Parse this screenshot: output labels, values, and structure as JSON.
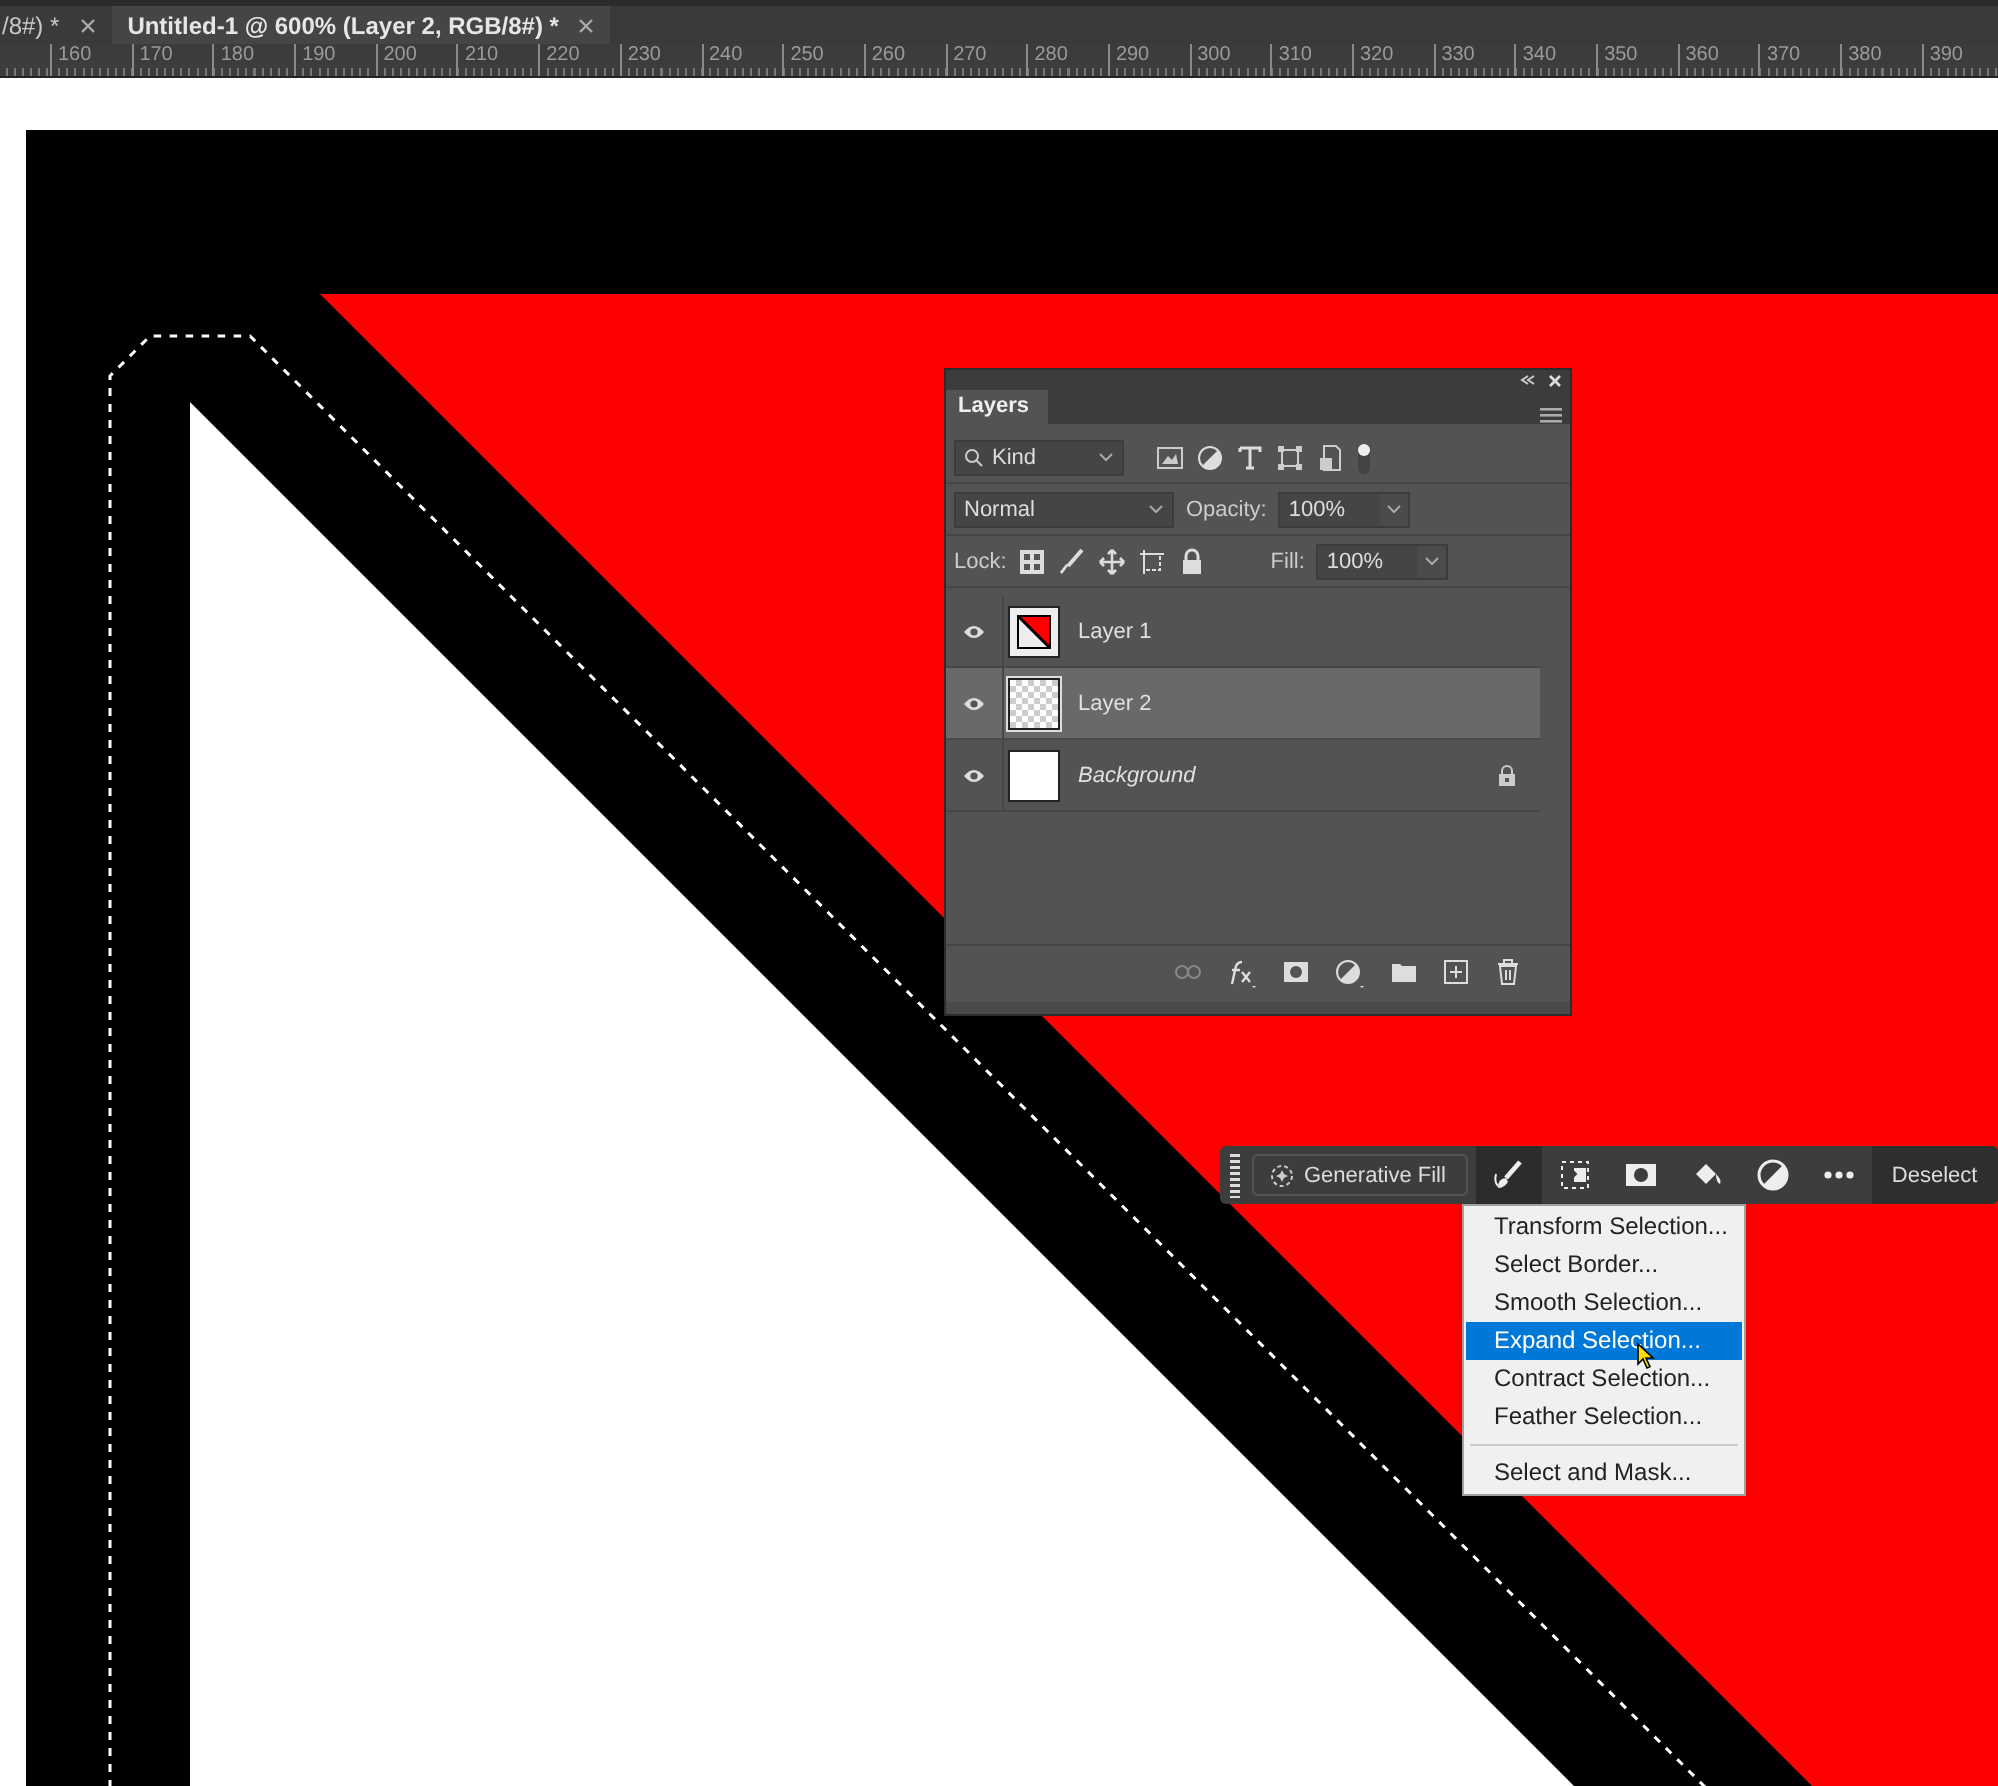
{
  "tabs": [
    {
      "label": "/8#) *",
      "selected": false
    },
    {
      "label": "Untitled-1 @ 600% (Layer 2, RGB/8#) *",
      "selected": true
    }
  ],
  "ruler": {
    "labels": [
      "160",
      "170",
      "180",
      "190",
      "200",
      "210",
      "220",
      "230",
      "240",
      "250",
      "260",
      "270",
      "280",
      "290",
      "300",
      "310",
      "320",
      "330",
      "340",
      "350",
      "360",
      "370",
      "380",
      "390"
    ]
  },
  "layers_panel": {
    "title": "Layers",
    "filter": "Kind",
    "blend_mode": "Normal",
    "opacity_label": "Opacity:",
    "opacity": "100%",
    "lock_label": "Lock:",
    "fill_label": "Fill:",
    "fill": "100%",
    "layers": [
      {
        "name": "Layer 1",
        "kind": "shape",
        "visible": true,
        "selected": false,
        "locked": false
      },
      {
        "name": "Layer 2",
        "kind": "transparent",
        "visible": true,
        "selected": true,
        "locked": false
      },
      {
        "name": "Background",
        "kind": "background",
        "visible": true,
        "selected": false,
        "locked": true
      }
    ]
  },
  "taskbar": {
    "generate_label": "Generative Fill",
    "action": "Deselect"
  },
  "menu": {
    "groups": [
      [
        {
          "label": "Transform Selection...",
          "selected": false
        },
        {
          "label": "Select Border...",
          "selected": false
        },
        {
          "label": "Smooth Selection...",
          "selected": false
        },
        {
          "label": "Expand Selection...",
          "selected": true
        },
        {
          "label": "Contract Selection...",
          "selected": false
        },
        {
          "label": "Feather Selection...",
          "selected": false
        }
      ],
      [
        {
          "label": "Select and Mask...",
          "selected": false
        }
      ]
    ]
  }
}
